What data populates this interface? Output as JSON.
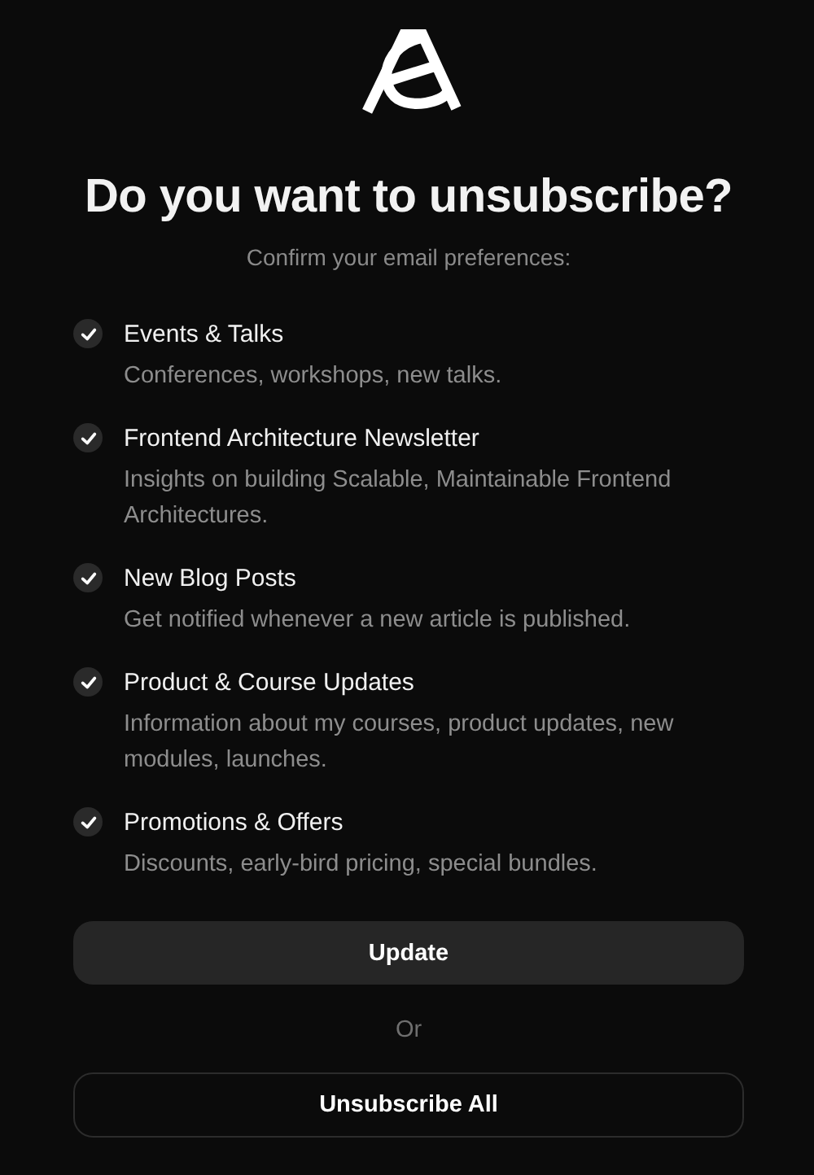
{
  "title": "Do you want to unsubscribe?",
  "subtitle": "Confirm your email preferences:",
  "preferences": [
    {
      "label": "Events & Talks",
      "description": "Conferences, workshops, new talks.",
      "checked": true
    },
    {
      "label": "Frontend Architecture Newsletter",
      "description": "Insights on building Scalable, Maintainable Frontend Architectures.",
      "checked": true
    },
    {
      "label": "New Blog Posts",
      "description": "Get notified whenever a new article is published.",
      "checked": true
    },
    {
      "label": "Product & Course Updates",
      "description": "Information about my courses, product updates, new modules, launches.",
      "checked": true
    },
    {
      "label": "Promotions & Offers",
      "description": "Discounts, early-bird pricing, special bundles.",
      "checked": true
    }
  ],
  "update_button": "Update",
  "separator": "Or",
  "unsubscribe_button": "Unsubscribe All"
}
